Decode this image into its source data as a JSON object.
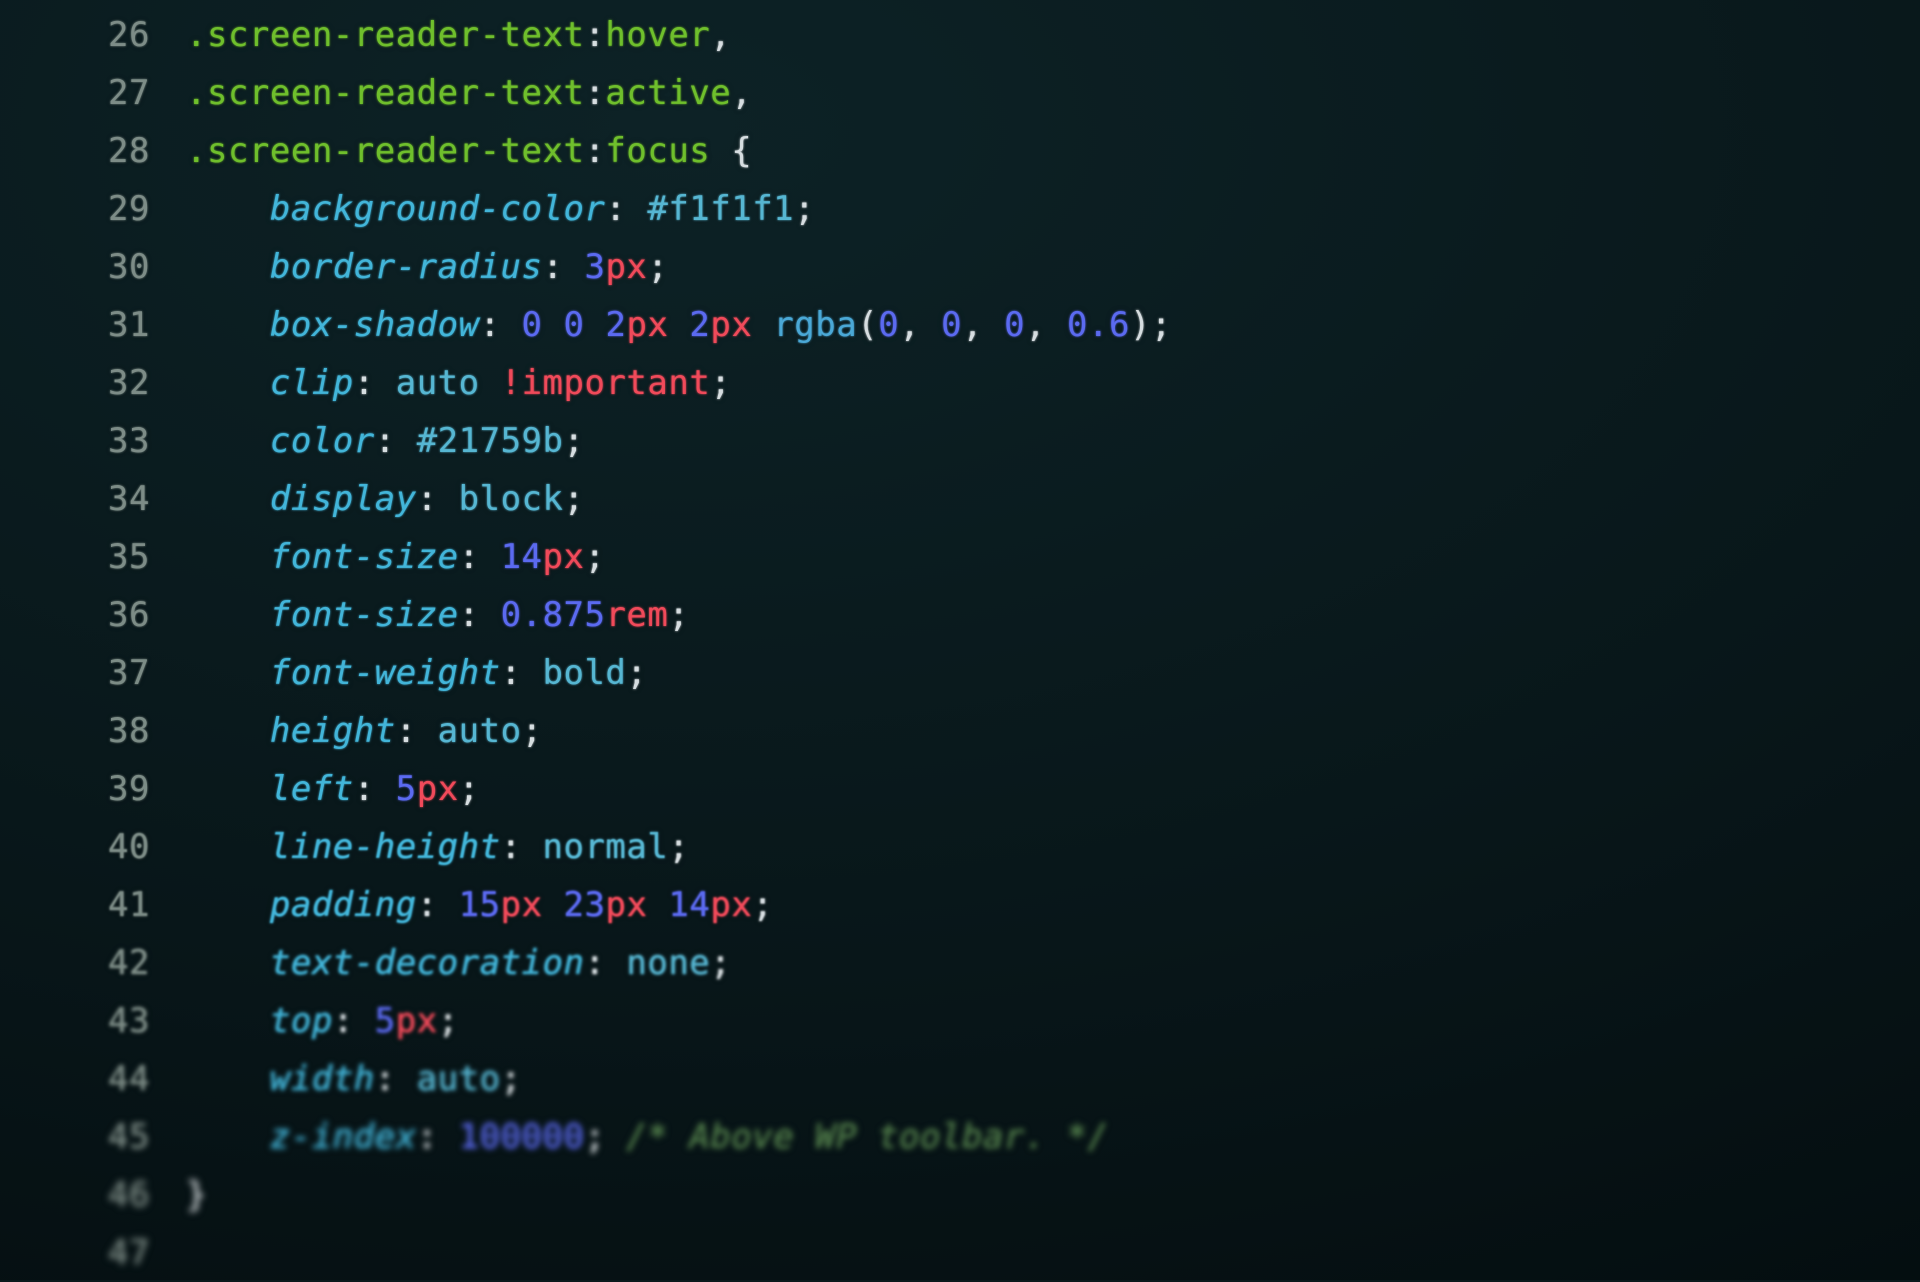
{
  "lines": [
    {
      "n": "26",
      "tokens": [
        {
          "c": "sel",
          "t": ".screen-reader-text"
        },
        {
          "c": "punc",
          "t": ":"
        },
        {
          "c": "pseudo",
          "t": "hover"
        },
        {
          "c": "punc",
          "t": ","
        }
      ]
    },
    {
      "n": "27",
      "tokens": [
        {
          "c": "sel",
          "t": ".screen-reader-text"
        },
        {
          "c": "punc",
          "t": ":"
        },
        {
          "c": "pseudo",
          "t": "active"
        },
        {
          "c": "punc",
          "t": ","
        }
      ]
    },
    {
      "n": "28",
      "tokens": [
        {
          "c": "sel",
          "t": ".screen-reader-text"
        },
        {
          "c": "punc",
          "t": ":"
        },
        {
          "c": "pseudo",
          "t": "focus"
        },
        {
          "c": "punc",
          "t": " {"
        }
      ]
    },
    {
      "n": "29",
      "indent": "    ",
      "tokens": [
        {
          "c": "prop",
          "t": "background-color"
        },
        {
          "c": "punc",
          "t": ": "
        },
        {
          "c": "val",
          "t": "#f1f1f1"
        },
        {
          "c": "punc",
          "t": ";"
        }
      ]
    },
    {
      "n": "30",
      "indent": "    ",
      "tokens": [
        {
          "c": "prop",
          "t": "border-radius"
        },
        {
          "c": "punc",
          "t": ": "
        },
        {
          "c": "num",
          "t": "3"
        },
        {
          "c": "unit",
          "t": "px"
        },
        {
          "c": "punc",
          "t": ";"
        }
      ]
    },
    {
      "n": "31",
      "indent": "    ",
      "tokens": [
        {
          "c": "prop",
          "t": "box-shadow"
        },
        {
          "c": "punc",
          "t": ": "
        },
        {
          "c": "num",
          "t": "0"
        },
        {
          "c": "punc",
          "t": " "
        },
        {
          "c": "num",
          "t": "0"
        },
        {
          "c": "punc",
          "t": " "
        },
        {
          "c": "num",
          "t": "2"
        },
        {
          "c": "unit",
          "t": "px"
        },
        {
          "c": "punc",
          "t": " "
        },
        {
          "c": "num",
          "t": "2"
        },
        {
          "c": "unit",
          "t": "px"
        },
        {
          "c": "punc",
          "t": " "
        },
        {
          "c": "func",
          "t": "rgba"
        },
        {
          "c": "punc",
          "t": "("
        },
        {
          "c": "num",
          "t": "0"
        },
        {
          "c": "punc",
          "t": ", "
        },
        {
          "c": "num",
          "t": "0"
        },
        {
          "c": "punc",
          "t": ", "
        },
        {
          "c": "num",
          "t": "0"
        },
        {
          "c": "punc",
          "t": ", "
        },
        {
          "c": "num",
          "t": "0.6"
        },
        {
          "c": "punc",
          "t": ")"
        },
        {
          "c": "punc",
          "t": ";"
        }
      ]
    },
    {
      "n": "32",
      "indent": "    ",
      "tokens": [
        {
          "c": "prop",
          "t": "clip"
        },
        {
          "c": "punc",
          "t": ": "
        },
        {
          "c": "val",
          "t": "auto"
        },
        {
          "c": "punc",
          "t": " "
        },
        {
          "c": "imp",
          "t": "!important"
        },
        {
          "c": "punc",
          "t": ";"
        }
      ]
    },
    {
      "n": "33",
      "indent": "    ",
      "tokens": [
        {
          "c": "prop",
          "t": "color"
        },
        {
          "c": "punc",
          "t": ": "
        },
        {
          "c": "val",
          "t": "#21759b"
        },
        {
          "c": "punc",
          "t": ";"
        }
      ]
    },
    {
      "n": "34",
      "indent": "    ",
      "tokens": [
        {
          "c": "prop",
          "t": "display"
        },
        {
          "c": "punc",
          "t": ": "
        },
        {
          "c": "val",
          "t": "block"
        },
        {
          "c": "punc",
          "t": ";"
        }
      ]
    },
    {
      "n": "35",
      "indent": "    ",
      "tokens": [
        {
          "c": "prop",
          "t": "font-size"
        },
        {
          "c": "punc",
          "t": ": "
        },
        {
          "c": "num",
          "t": "14"
        },
        {
          "c": "unit",
          "t": "px"
        },
        {
          "c": "punc",
          "t": ";"
        }
      ]
    },
    {
      "n": "36",
      "indent": "    ",
      "tokens": [
        {
          "c": "prop",
          "t": "font-size"
        },
        {
          "c": "punc",
          "t": ": "
        },
        {
          "c": "num",
          "t": "0.875"
        },
        {
          "c": "unit",
          "t": "rem"
        },
        {
          "c": "punc",
          "t": ";"
        }
      ]
    },
    {
      "n": "37",
      "indent": "    ",
      "tokens": [
        {
          "c": "prop",
          "t": "font-weight"
        },
        {
          "c": "punc",
          "t": ": "
        },
        {
          "c": "val",
          "t": "bold"
        },
        {
          "c": "punc",
          "t": ";"
        }
      ]
    },
    {
      "n": "38",
      "indent": "    ",
      "tokens": [
        {
          "c": "prop",
          "t": "height"
        },
        {
          "c": "punc",
          "t": ": "
        },
        {
          "c": "val",
          "t": "auto"
        },
        {
          "c": "punc",
          "t": ";"
        }
      ]
    },
    {
      "n": "39",
      "indent": "    ",
      "tokens": [
        {
          "c": "prop",
          "t": "left"
        },
        {
          "c": "punc",
          "t": ": "
        },
        {
          "c": "num",
          "t": "5"
        },
        {
          "c": "unit",
          "t": "px"
        },
        {
          "c": "punc",
          "t": ";"
        }
      ]
    },
    {
      "n": "40",
      "indent": "    ",
      "tokens": [
        {
          "c": "prop",
          "t": "line-height"
        },
        {
          "c": "punc",
          "t": ": "
        },
        {
          "c": "val",
          "t": "normal"
        },
        {
          "c": "punc",
          "t": ";"
        }
      ]
    },
    {
      "n": "41",
      "indent": "    ",
      "tokens": [
        {
          "c": "prop",
          "t": "padding"
        },
        {
          "c": "punc",
          "t": ": "
        },
        {
          "c": "num",
          "t": "15"
        },
        {
          "c": "unit",
          "t": "px"
        },
        {
          "c": "punc",
          "t": " "
        },
        {
          "c": "num",
          "t": "23"
        },
        {
          "c": "unit",
          "t": "px"
        },
        {
          "c": "punc",
          "t": " "
        },
        {
          "c": "num",
          "t": "14"
        },
        {
          "c": "unit",
          "t": "px"
        },
        {
          "c": "punc",
          "t": ";"
        }
      ]
    },
    {
      "n": "42",
      "indent": "    ",
      "tokens": [
        {
          "c": "prop",
          "t": "text-decoration"
        },
        {
          "c": "punc",
          "t": ": "
        },
        {
          "c": "val",
          "t": "none"
        },
        {
          "c": "punc",
          "t": ";"
        }
      ]
    },
    {
      "n": "43",
      "indent": "    ",
      "tokens": [
        {
          "c": "prop",
          "t": "top"
        },
        {
          "c": "punc",
          "t": ": "
        },
        {
          "c": "num",
          "t": "5"
        },
        {
          "c": "unit",
          "t": "px"
        },
        {
          "c": "punc",
          "t": ";"
        }
      ]
    },
    {
      "n": "44",
      "indent": "    ",
      "tokens": [
        {
          "c": "prop",
          "t": "width"
        },
        {
          "c": "punc",
          "t": ": "
        },
        {
          "c": "val",
          "t": "auto"
        },
        {
          "c": "punc",
          "t": ";"
        }
      ]
    },
    {
      "n": "45",
      "indent": "    ",
      "tokens": [
        {
          "c": "prop",
          "t": "z-index"
        },
        {
          "c": "punc",
          "t": ": "
        },
        {
          "c": "num",
          "t": "100000"
        },
        {
          "c": "punc",
          "t": "; "
        },
        {
          "c": "cmt",
          "t": "/* Above WP toolbar. */"
        }
      ]
    },
    {
      "n": "46",
      "tokens": [
        {
          "c": "punc",
          "t": "}"
        }
      ]
    },
    {
      "n": "47",
      "tokens": []
    }
  ]
}
